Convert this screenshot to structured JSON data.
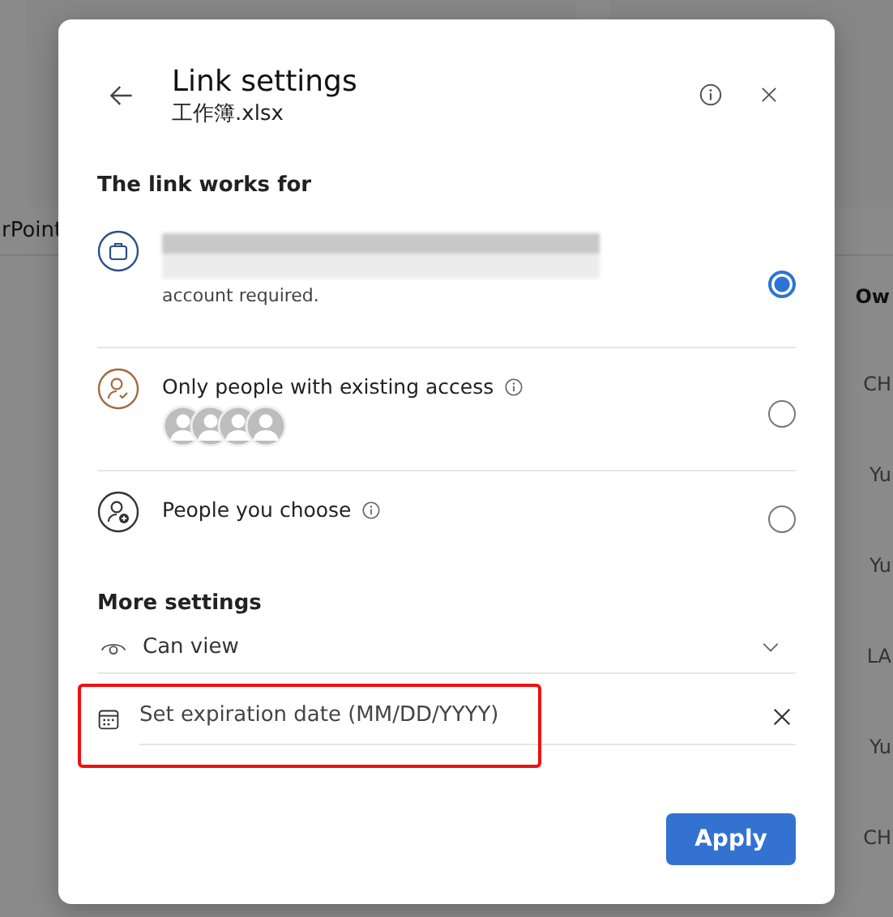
{
  "background": {
    "tab_label": "rPoint",
    "column_header": "Ow",
    "owner_cells": [
      "CH",
      "Yu",
      "Yu",
      "LA",
      "Yu",
      "CH"
    ]
  },
  "dialog": {
    "title": "Link settings",
    "subtitle": "工作簿.xlsx",
    "section_title": "The link works for",
    "options": [
      {
        "kind": "organization",
        "redacted": true,
        "description": "account required.",
        "info": false,
        "selected": true
      },
      {
        "kind": "existing",
        "label": "Only people with existing access",
        "info": true,
        "selected": false
      },
      {
        "kind": "choose",
        "label": "People you choose",
        "info": true,
        "selected": false
      }
    ],
    "more_settings_title": "More settings",
    "permission": "Can view",
    "expiration": {
      "placeholder": "Set expiration date (MM/DD/YYYY)",
      "highlighted": true
    },
    "apply_button": "Apply"
  }
}
